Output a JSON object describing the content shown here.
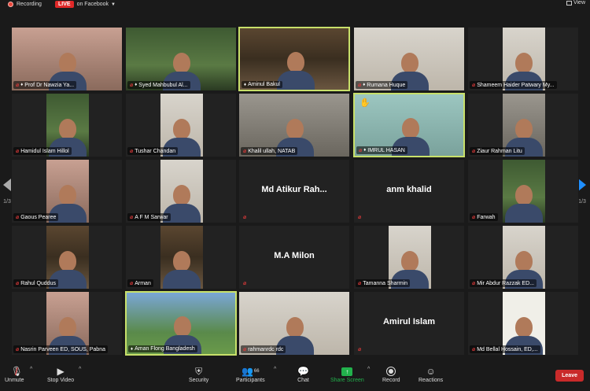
{
  "topbar": {
    "recording_label": "Recording",
    "live_tag": "LIVE",
    "live_text": "on Facebook",
    "view_label": "View"
  },
  "pager": {
    "left_page": "1/3",
    "right_page": "1/3"
  },
  "tiles": [
    {
      "name": "Prof Dr Nawzia Ya...",
      "bg": "bg-pink",
      "video": true,
      "muted": true,
      "pinned": true
    },
    {
      "name": "Syed Mahbubul Al...",
      "bg": "bg-green",
      "video": true,
      "muted": true,
      "pinned": true
    },
    {
      "name": "Aminul Bakul",
      "bg": "bg-shelf",
      "video": true,
      "muted": false,
      "pinned": true,
      "active": true
    },
    {
      "name": "Rumana Huque",
      "bg": "bg-white",
      "video": true,
      "muted": true,
      "pinned": true
    },
    {
      "name": "Shameem Haider Patwary My...",
      "bg": "bg-white",
      "video": true,
      "muted": true,
      "pinned": false
    },
    {
      "name": "Hamidul Islam Hillol",
      "bg": "bg-green",
      "video": true,
      "muted": true,
      "pinned": false
    },
    {
      "name": "Tushar Chandan",
      "bg": "bg-white",
      "video": true,
      "muted": true,
      "pinned": false
    },
    {
      "name": "Khalil ullah, NATAB",
      "bg": "bg-grey",
      "video": true,
      "muted": true,
      "pinned": false
    },
    {
      "name": "IMRUL HASAN",
      "bg": "bg-teal",
      "video": true,
      "muted": true,
      "pinned": true,
      "active": true,
      "hand": true
    },
    {
      "name": "Ziaur Rahman Litu",
      "bg": "bg-grey",
      "video": true,
      "muted": true,
      "pinned": false
    },
    {
      "name": "Gaous Pearee",
      "bg": "bg-pink",
      "video": true,
      "muted": true,
      "pinned": false
    },
    {
      "name": "A F M Sarwar",
      "bg": "bg-white",
      "video": true,
      "muted": true,
      "pinned": false
    },
    {
      "name": "",
      "center_name": "Md Atikur Rah...",
      "video": false,
      "muted": true,
      "pinned": false
    },
    {
      "name": "",
      "center_name": "anm khalid",
      "video": false,
      "muted": true,
      "pinned": false
    },
    {
      "name": "Farwah",
      "bg": "bg-green",
      "video": true,
      "muted": true,
      "pinned": false
    },
    {
      "name": "Rahul Quddus",
      "bg": "bg-shelf",
      "video": true,
      "muted": true,
      "pinned": false
    },
    {
      "name": "Arman",
      "bg": "bg-shelf",
      "video": true,
      "muted": true,
      "pinned": false
    },
    {
      "name": "",
      "center_name": "M.A Milon",
      "video": false,
      "muted": true,
      "pinned": false
    },
    {
      "name": "Tamanna Sharmin",
      "bg": "bg-white",
      "video": true,
      "muted": true,
      "pinned": false
    },
    {
      "name": "Mir Abdur Razzak ED...",
      "bg": "bg-white",
      "video": true,
      "muted": true,
      "pinned": false
    },
    {
      "name": "Nasrin Parveen ED, SOUS, Pabna",
      "bg": "bg-pink",
      "video": true,
      "muted": true,
      "pinned": false
    },
    {
      "name": "Aman Flong Bangladesh",
      "bg": "bg-sky",
      "video": true,
      "muted": false,
      "pinned": true,
      "active": true
    },
    {
      "name": "rahmanrdc rdc",
      "bg": "bg-white",
      "video": true,
      "muted": true,
      "pinned": false
    },
    {
      "name": "",
      "center_name": "Amirul Islam",
      "video": false,
      "muted": true,
      "pinned": false
    },
    {
      "name": "Md Bellal Hossain, ED,...",
      "bg": "bg-card",
      "video": true,
      "muted": true,
      "pinned": false
    }
  ],
  "toolbar": {
    "unmute": "Unmute",
    "stop_video": "Stop Video",
    "security": "Security",
    "participants": "Participants",
    "participants_count": "66",
    "chat": "Chat",
    "share_screen": "Share Screen",
    "record": "Record",
    "reactions": "Reactions",
    "leave": "Leave"
  }
}
